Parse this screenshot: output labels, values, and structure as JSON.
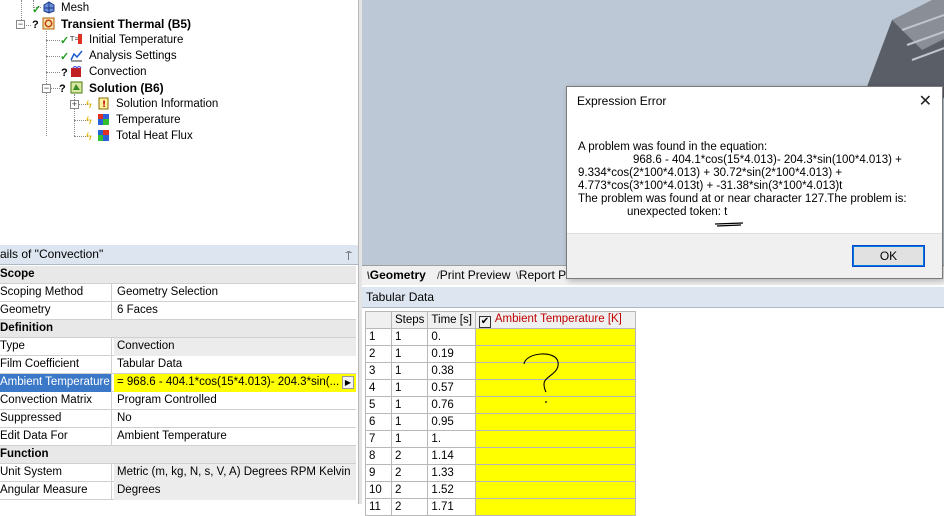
{
  "tree": {
    "items": [
      {
        "label": "Mesh",
        "state": "check"
      },
      {
        "label": "Transient Thermal (B5)",
        "state": "question"
      },
      {
        "label": "Initial Temperature",
        "state": "check"
      },
      {
        "label": "Analysis Settings",
        "state": "check"
      },
      {
        "label": "Convection",
        "state": "question"
      },
      {
        "label": "Solution (B6)",
        "state": "question"
      },
      {
        "label": "Solution Information",
        "state": "bolt"
      },
      {
        "label": "Temperature",
        "state": "bolt"
      },
      {
        "label": "Total Heat Flux",
        "state": "bolt"
      }
    ]
  },
  "graphics_tabs": [
    {
      "label": "Geometry"
    },
    {
      "label": "Print Preview"
    },
    {
      "label": "Report P"
    }
  ],
  "details": {
    "title": "ails of \"Convection\"",
    "pin": "⍑",
    "rows": [
      {
        "section": "Scope"
      },
      {
        "key": "Scoping Method",
        "value": "Geometry Selection"
      },
      {
        "key": "Geometry",
        "value": "6 Faces"
      },
      {
        "section": "Definition"
      },
      {
        "key": "Type",
        "value": "Convection"
      },
      {
        "key": "Film Coefficient",
        "value": "Tabular Data"
      },
      {
        "key": "Ambient Temperature",
        "value": "=   968.6 - 404.1*cos(15*4.013)- 204.3*sin(..."
      },
      {
        "key": "Convection Matrix",
        "value": "Program Controlled"
      },
      {
        "key": "Suppressed",
        "value": "No"
      },
      {
        "key": "Edit Data For",
        "value": "Ambient Temperature"
      },
      {
        "section": "Function"
      },
      {
        "key": "Unit System",
        "value": "Metric (m, kg, N, s, V, A)  Degrees  RPM  Kelvin"
      },
      {
        "key": "Angular Measure",
        "value": "Degrees"
      }
    ]
  },
  "tabular": {
    "title": "Tabular Data",
    "headers": {
      "steps": "Steps",
      "time": "Time [s]",
      "ambient": "Ambient Temperature [K]"
    },
    "rows": [
      {
        "n": "1",
        "steps": "1",
        "time": "0."
      },
      {
        "n": "2",
        "steps": "1",
        "time": "0.19"
      },
      {
        "n": "3",
        "steps": "1",
        "time": "0.38"
      },
      {
        "n": "4",
        "steps": "1",
        "time": "0.57"
      },
      {
        "n": "5",
        "steps": "1",
        "time": "0.76"
      },
      {
        "n": "6",
        "steps": "1",
        "time": "0.95"
      },
      {
        "n": "7",
        "steps": "1",
        "time": "1."
      },
      {
        "n": "8",
        "steps": "2",
        "time": "1.14"
      },
      {
        "n": "9",
        "steps": "2",
        "time": "1.33"
      },
      {
        "n": "10",
        "steps": "2",
        "time": "1.52"
      },
      {
        "n": "11",
        "steps": "2",
        "time": "1.71"
      }
    ],
    "annotation": "?"
  },
  "dialog": {
    "title": "Expression Error",
    "close": "✕",
    "lines": [
      "A problem was found in the equation:",
      "968.6 - 404.1*cos(15*4.013)- 204.3*sin(100*4.013) +",
      "9.334*cos(2*100*4.013) + 30.72*sin(2*100*4.013) +",
      "4.773*cos(3*100*4.013t) + -31.38*sin(3*100*4.013)t",
      "The problem was found at or near character  127.The problem is:",
      "unexpected token: t"
    ],
    "ok_label": "OK"
  },
  "colors": {
    "selection": "#3b78c8",
    "highlight": "#ffff00",
    "ambient_header": "#c00000",
    "check": "#1a9e1a"
  }
}
